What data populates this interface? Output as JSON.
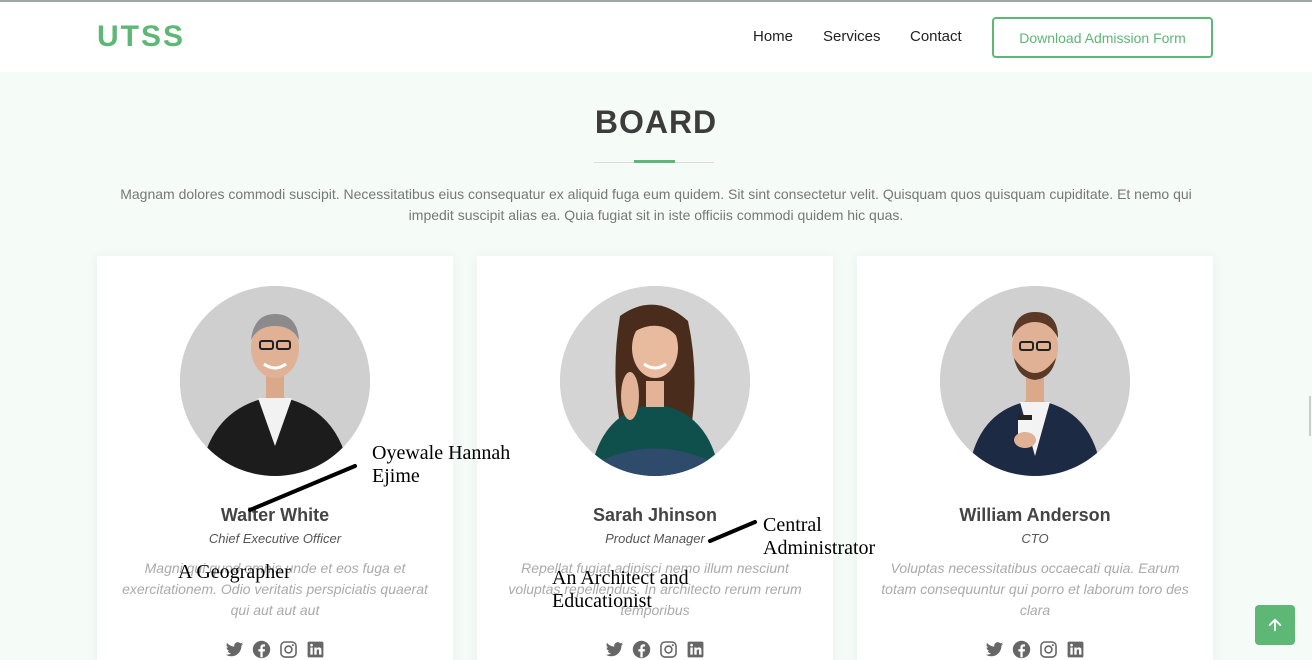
{
  "header": {
    "logo": "UTSS",
    "nav": [
      "Home",
      "Services",
      "Contact"
    ],
    "cta": "Download Admission Form"
  },
  "section": {
    "title": "BOARD",
    "description": "Magnam dolores commodi suscipit. Necessitatibus eius consequatur ex aliquid fuga eum quidem. Sit sint consectetur velit. Quisquam quos quisquam cupiditate. Et nemo qui impedit suscipit alias ea. Quia fugiat sit in iste officiis commodi quidem hic quas."
  },
  "members": [
    {
      "name": "Walter White",
      "role": "Chief Executive Officer",
      "bio": "Magni qui quod omnis unde et eos fuga et exercitationem. Odio veritatis perspiciatis quaerat qui aut aut aut",
      "socials": [
        "twitter-icon",
        "facebook-icon",
        "instagram-icon",
        "linkedin-icon"
      ]
    },
    {
      "name": "Sarah Jhinson",
      "role": "Product Manager",
      "bio": "Repellat fugiat adipisci nemo illum nesciunt voluptas repellendus. In architecto rerum rerum temporibus",
      "socials": [
        "twitter-icon",
        "facebook-icon",
        "instagram-icon",
        "linkedin-icon"
      ]
    },
    {
      "name": "William Anderson",
      "role": "CTO",
      "bio": "Voluptas necessitatibus occaecati quia. Earum totam consequuntur qui porro et laborum toro des clara",
      "socials": [
        "twitter-icon",
        "facebook-icon",
        "instagram-icon",
        "linkedin-icon"
      ]
    }
  ],
  "annotations": {
    "a1": [
      "Oyewale Hannah",
      "Ejime"
    ],
    "a2": "A Geographer",
    "a3": [
      "Central",
      "Administrator"
    ],
    "a4": [
      "An Architect and",
      "Educationist"
    ]
  },
  "colors": {
    "accent": "#5cb874",
    "background": "#f5fbf7"
  }
}
